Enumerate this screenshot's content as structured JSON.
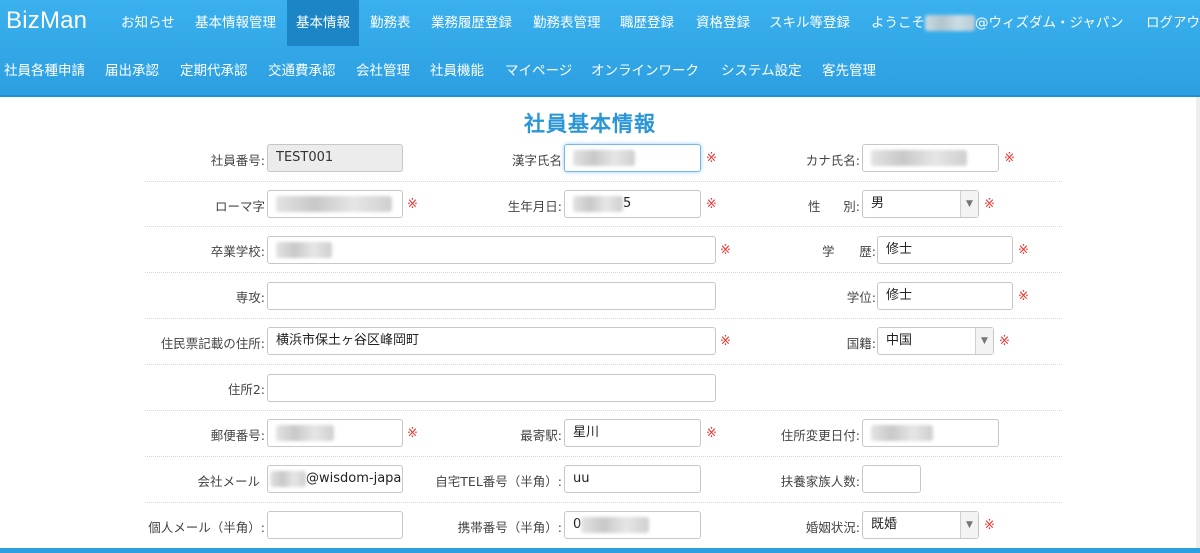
{
  "app": {
    "brand": "BizMan"
  },
  "nav_primary": [
    {
      "label": "お知らせ"
    },
    {
      "label": "基本情報管理"
    },
    {
      "label": "基本情報",
      "active": true
    },
    {
      "label": "勤務表"
    },
    {
      "label": "業務履歴登録"
    },
    {
      "label": "勤務表管理"
    },
    {
      "label": "職歴登録"
    },
    {
      "label": "資格登録"
    },
    {
      "label": "スキル等登録"
    }
  ],
  "user": {
    "greeting_prefix": "ようこそ",
    "greeting_suffix": "@ウィズダム・ジャパン",
    "logout": "ログアウト"
  },
  "nav_secondary": [
    {
      "label": "社員各種申請"
    },
    {
      "label": "届出承認"
    },
    {
      "label": "定期代承認"
    },
    {
      "label": "交通費承認"
    },
    {
      "label": "会社管理"
    },
    {
      "label": "社員機能"
    },
    {
      "label": "マイページ"
    },
    {
      "label": "オンラインワーク"
    },
    {
      "label": "システム設定"
    },
    {
      "label": "客先管理"
    }
  ],
  "form": {
    "title": "社員基本情報",
    "required_mark": "※",
    "employee_no": {
      "label": "社員番号:",
      "value": "TEST001"
    },
    "kanji_name": {
      "label": "漢字氏名"
    },
    "kana_name": {
      "label": "カナ氏名:"
    },
    "romaji": {
      "label": "ローマ字"
    },
    "birth_date": {
      "label": "生年月日:",
      "value_suffix": "5"
    },
    "gender": {
      "label_a": "性",
      "label_b": "別:",
      "value": "男"
    },
    "school": {
      "label": "卒業学校:"
    },
    "education": {
      "label_a": "学",
      "label_b": "歴:",
      "value": "修士"
    },
    "major": {
      "label": "専攻:",
      "value": ""
    },
    "degree": {
      "label": "学位:",
      "value": "修士"
    },
    "address": {
      "label": "住民票記載の住所:",
      "value": "横浜市保土ヶ谷区峰岡町"
    },
    "nationality": {
      "label": "国籍:",
      "value": "中国"
    },
    "address2": {
      "label": "住所2:",
      "value": ""
    },
    "postal_code": {
      "label": "郵便番号:"
    },
    "nearest_station": {
      "label": "最寄駅:",
      "value": "星川"
    },
    "address_change_date": {
      "label": "住所変更日付:"
    },
    "company_email": {
      "label": "会社メール",
      "value_suffix": "@wisdom-japa"
    },
    "home_tel": {
      "label": "自宅TEL番号（半角）:",
      "value": "uu"
    },
    "dependents": {
      "label": "扶養家族人数:",
      "value": ""
    },
    "personal_email": {
      "label": "個人メール（半角）:",
      "value": ""
    },
    "mobile": {
      "label": "携帯番号（半角）:",
      "value_prefix": "0"
    },
    "marital_status": {
      "label": "婚姻状況:",
      "value": "既婚"
    }
  },
  "colors": {
    "header": "#2c9fe1",
    "active_tab": "#1b85c6",
    "title": "#2b96d6",
    "required": "#e53935"
  }
}
